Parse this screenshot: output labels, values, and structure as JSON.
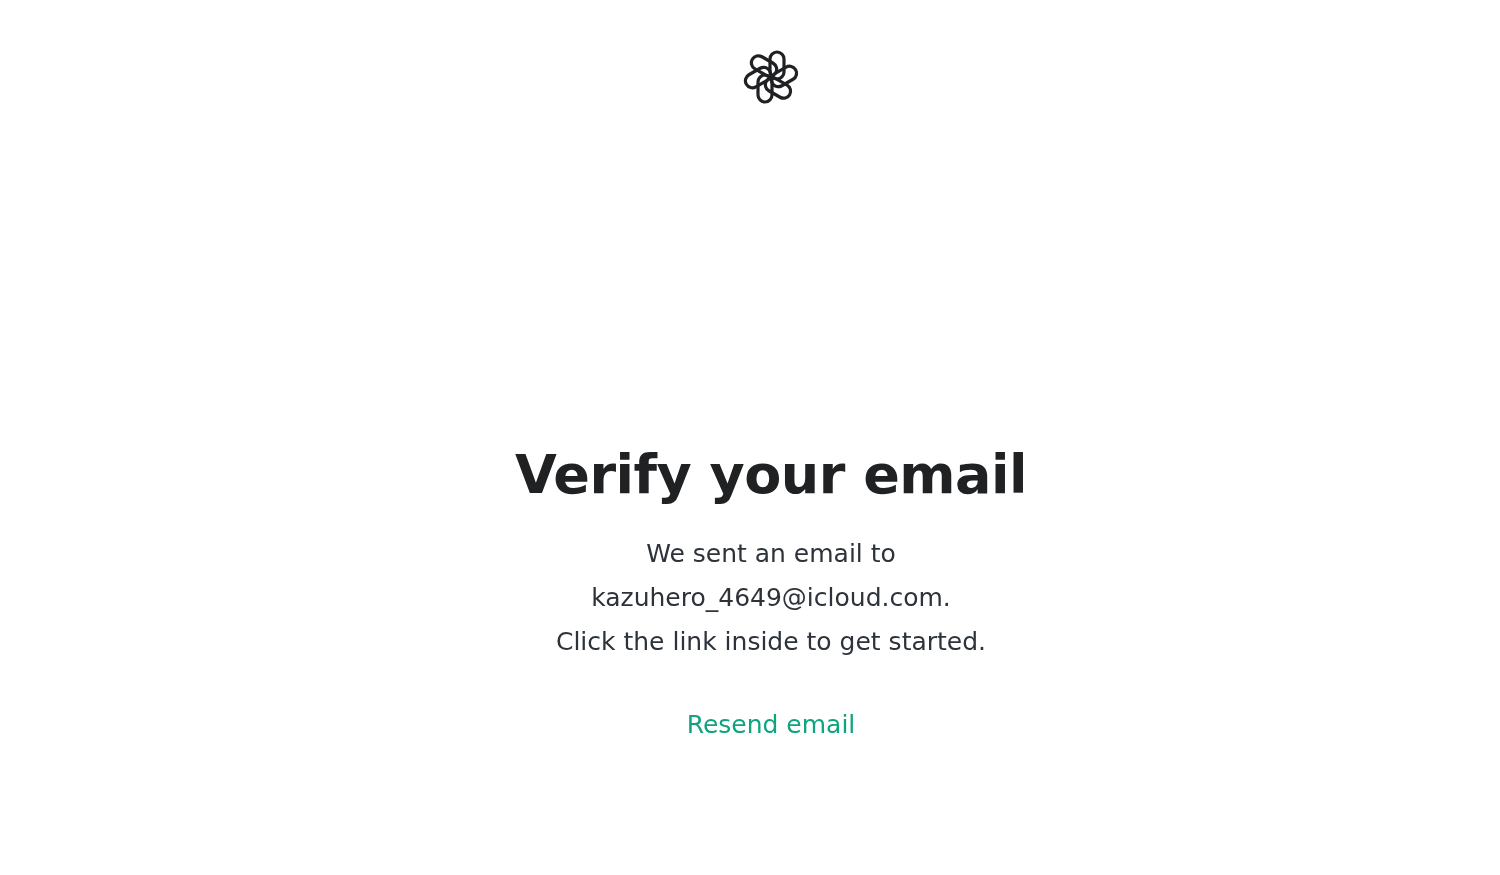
{
  "heading": "Verify your email",
  "message": "We sent an email to\nkazuhero_4649@icloud.com.\nClick the link inside to get started.",
  "resend_link": "Resend email"
}
